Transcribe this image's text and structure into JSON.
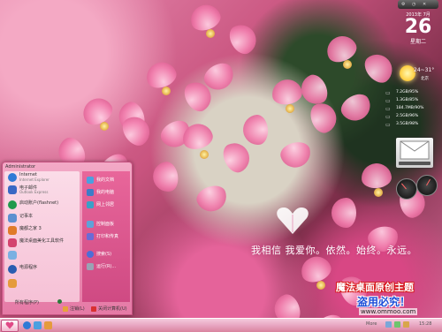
{
  "clock": {
    "date_line": "2013年 7月",
    "day": "26",
    "weekday": "星期二"
  },
  "weather": {
    "temp": "24~31°",
    "city": "北京"
  },
  "netmeter": {
    "rows": [
      "7.2GB/95%",
      "1.3GB/85%",
      "184.7MB/90%",
      "2.5GB/96%",
      "3.5GB/98%"
    ]
  },
  "message": "我相信 我爱你。依然。始终。永远。",
  "watermark": {
    "title": "魔法桌面原创主题",
    "sub": "盗用必究！",
    "url": "www.ommoo.com"
  },
  "start_menu": {
    "user": "Administrator",
    "left_items": [
      {
        "label": "Internet",
        "sub": "Internet Explorer",
        "color": "#2f7ad6"
      },
      {
        "label": "电子邮件",
        "sub": "Outlook Express",
        "color": "#3a68c4"
      },
      {
        "label": "启动账户(flashnet)",
        "sub": "",
        "color": "#1f9a4c"
      },
      {
        "label": "记事本",
        "sub": "",
        "color": "#5b8fd0"
      },
      {
        "label": "魔都之家 3",
        "sub": "",
        "color": "#e07b2a"
      },
      {
        "label": "魔法桌面美化工具软件",
        "sub": "",
        "color": "#d4446f"
      },
      {
        "label": "",
        "sub": "",
        "color": "#7ab0e2"
      },
      {
        "label": "电源程序",
        "sub": "",
        "color": "#2a5db0"
      },
      {
        "label": "",
        "sub": "",
        "color": "#e59b3c"
      }
    ],
    "all_programs": "所有程序(P)",
    "right_items": [
      {
        "label": "我的文档",
        "color": "#4aa0e0"
      },
      {
        "label": "我的电脑",
        "color": "#3d7cc8"
      },
      {
        "label": "网上邻居",
        "color": "#3aa0c8"
      },
      {
        "label": "控制面板",
        "color": "#5fa2d8"
      },
      {
        "label": "打印和传真",
        "color": "#6b6bd6"
      },
      {
        "label": "搜索(S)",
        "color": "#4c6ed8"
      },
      {
        "label": "运行(R)...",
        "color": "#9aa3b4"
      }
    ],
    "logoff_label": "注销(L)",
    "shutdown_label": "关闭计算机(U)"
  },
  "taskbar": {
    "tray_label": "More",
    "time": "15:28"
  },
  "colors": {
    "accent": "#e57aa6",
    "taskbar": "#f4cbdc",
    "watermark_red": "#d61818",
    "watermark_blue": "#1a4cd8"
  }
}
